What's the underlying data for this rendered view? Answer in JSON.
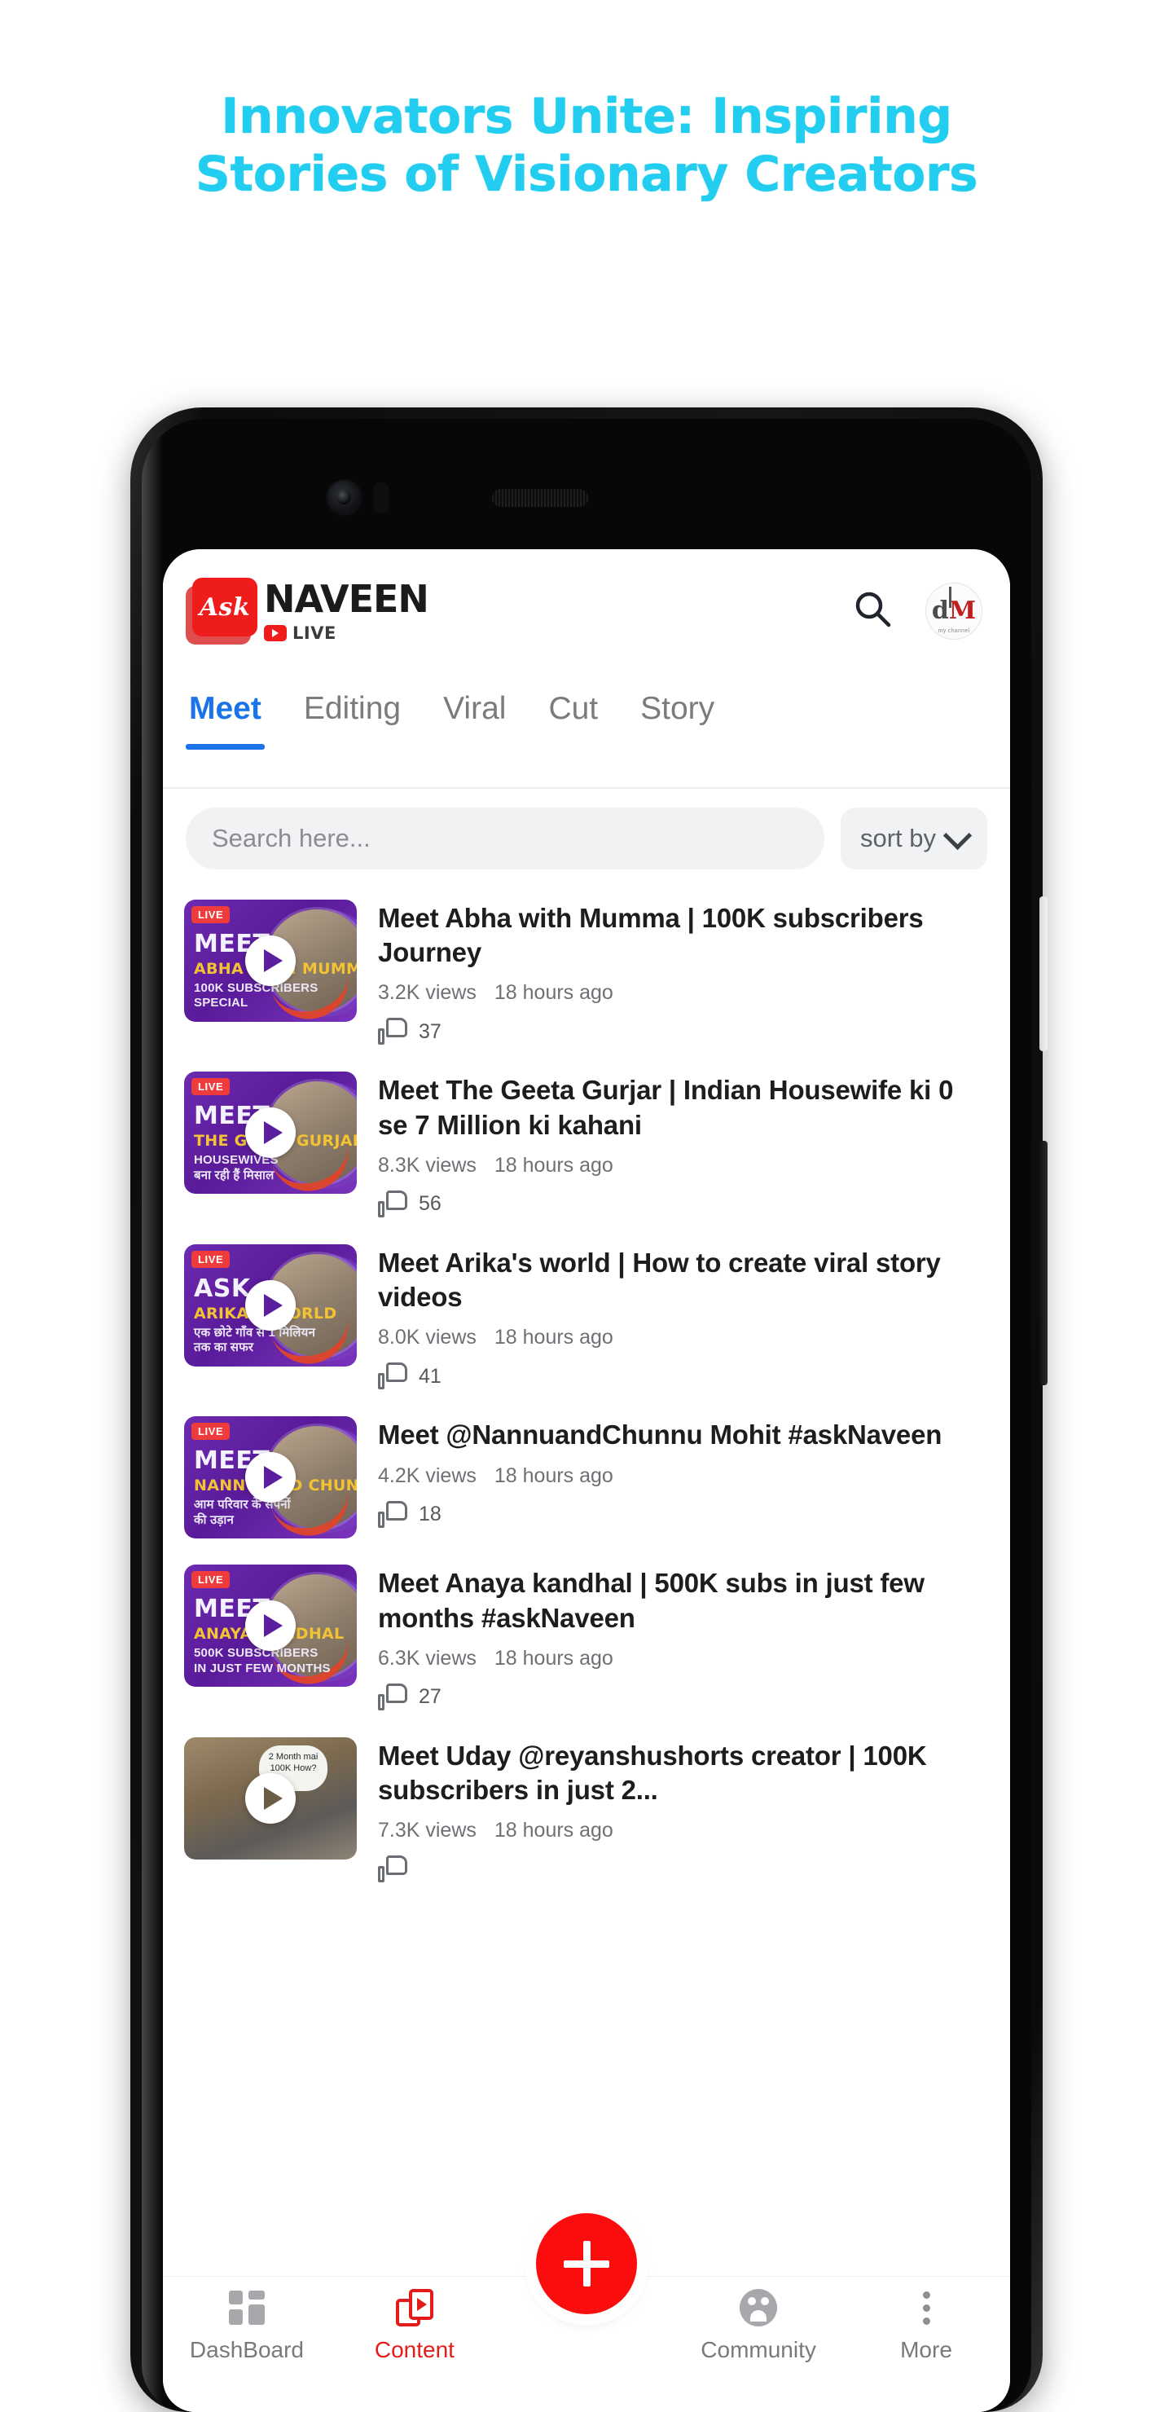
{
  "promo": {
    "line1": "Innovators Unite: Inspiring",
    "line2": "Stories of Visionary Creators",
    "color": "#22cdf0"
  },
  "appbar": {
    "logo_badge": "Ask",
    "logo_name": "NAVEEN",
    "logo_live": "LIVE",
    "search_icon": "search-icon",
    "avatar_initials_d": "d",
    "avatar_initials_m": "M",
    "avatar_tagline": "my channel"
  },
  "tabs": [
    {
      "label": "Meet",
      "active": true
    },
    {
      "label": "Editing",
      "active": false
    },
    {
      "label": "Viral",
      "active": false
    },
    {
      "label": "Cut",
      "active": false
    },
    {
      "label": "Story",
      "active": false
    }
  ],
  "search": {
    "placeholder": "Search here...",
    "sort_label": "sort by"
  },
  "videos": [
    {
      "title": "Meet Abha with Mumma | 100K subscribers Journey",
      "views": "3.2K views",
      "age": "18 hours ago",
      "likes": "37",
      "badge": "LIVE",
      "thumb_meet": "MEET",
      "thumb_sub": "ABHA WITH MUMMA",
      "thumb_desc": "100K SUBSCRIBERS\nSPECIAL",
      "thumb_style": "purple"
    },
    {
      "title": "Meet The Geeta Gurjar | Indian Housewife ki 0 se 7 Million ki kahani",
      "views": "8.3K views",
      "age": "18 hours ago",
      "likes": "56",
      "badge": "LIVE",
      "thumb_meet": "MEET",
      "thumb_sub": "THE GEETA GURJAR",
      "thumb_desc": "HOUSEWIVES\nबना रही हैं मिसाल",
      "thumb_style": "purple"
    },
    {
      "title": "Meet Arika's world | How to create viral story videos",
      "views": "8.0K views",
      "age": "18 hours ago",
      "likes": "41",
      "badge": "LIVE",
      "thumb_meet": "ASK",
      "thumb_sub": "ARIKA'S WORLD",
      "thumb_desc": "एक छोटे गाँव से 1 मिलियन\nतक का सफर",
      "thumb_style": "purple"
    },
    {
      "title": "Meet @NannuandChunnu Mohit #askNaveen",
      "views": "4.2K views",
      "age": "18 hours ago",
      "likes": "18",
      "badge": "LIVE",
      "thumb_meet": "MEET",
      "thumb_sub": "NANNU AND CHUNNU",
      "thumb_desc": "आम परिवार के सपनों\nकी उड़ान",
      "thumb_style": "purple"
    },
    {
      "title": "Meet Anaya kandhal | 500K subs in just few months #askNaveen",
      "views": "6.3K views",
      "age": "18 hours ago",
      "likes": "27",
      "badge": "LIVE",
      "thumb_meet": "MEET",
      "thumb_sub": "ANAYA KANDHAL",
      "thumb_desc": "500K SUBSCRIBERS\nIN JUST FEW MONTHS",
      "thumb_style": "purple"
    },
    {
      "title": "Meet Uday @reyanshushorts creator | 100K subscribers in just 2...",
      "views": "7.3K views",
      "age": "18 hours ago",
      "likes": "",
      "badge": "",
      "thumb_meet": "",
      "thumb_sub": "",
      "thumb_desc": "",
      "thumb_bubble": "2 Month mai\n100K How?",
      "thumb_style": "photo"
    }
  ],
  "fab": {
    "label": "add-new",
    "icon": "plus-icon",
    "color": "#fb0d0d"
  },
  "bottomnav": [
    {
      "label": "DashBoard",
      "icon": "dashboard-icon",
      "active": false
    },
    {
      "label": "Content",
      "icon": "content-icon",
      "active": true
    },
    {
      "label": "Community",
      "icon": "community-icon",
      "active": false
    },
    {
      "label": "More",
      "icon": "more-icon",
      "active": false
    }
  ]
}
